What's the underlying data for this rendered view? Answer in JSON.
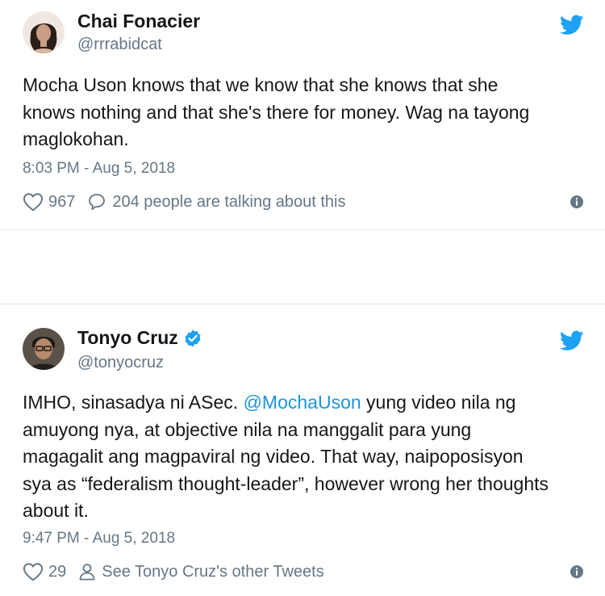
{
  "tweets": [
    {
      "author": {
        "name": "Chai Fonacier",
        "handle": "@rrrabidcat",
        "verified": false
      },
      "text_lines": [
        "Mocha Uson knows that we know that she knows that she",
        "knows nothing and that she's there for money. Wag na tayong",
        "maglokohan."
      ],
      "timestamp": "8:03 PM - Aug 5, 2018",
      "likes": "967",
      "engagement_text": "204 people are talking about this"
    },
    {
      "author": {
        "name": "Tonyo Cruz",
        "handle": "@tonyocruz",
        "verified": true
      },
      "text": {
        "line1_before": "IMHO, sinasadya ni ASec. ",
        "mention": "@MochaUson",
        "line1_after": " yung video nila ng",
        "line2": "amuyong nya, at objective nila na manggalit para yung",
        "line3": "magagalit ang magpaviral ng video. That way, naipoposisyon",
        "line4": "sya as “federalism thought-leader”, however wrong her thoughts",
        "line5": "about it."
      },
      "timestamp": "9:47 PM - Aug 5, 2018",
      "likes": "29",
      "engagement_text": "See Tonyo Cruz's other Tweets"
    }
  ],
  "colors": {
    "text_primary": "#14171a",
    "text_secondary": "#657786",
    "twitter_blue": "#1da1f2",
    "mention_blue": "#1b95e0",
    "border": "#e1e8ed"
  },
  "icons": {
    "brand": "twitter-bird-icon",
    "like": "heart-icon",
    "reply": "speech-bubble-icon",
    "profile": "person-icon",
    "info": "info-icon",
    "verified": "verified-badge-icon"
  }
}
